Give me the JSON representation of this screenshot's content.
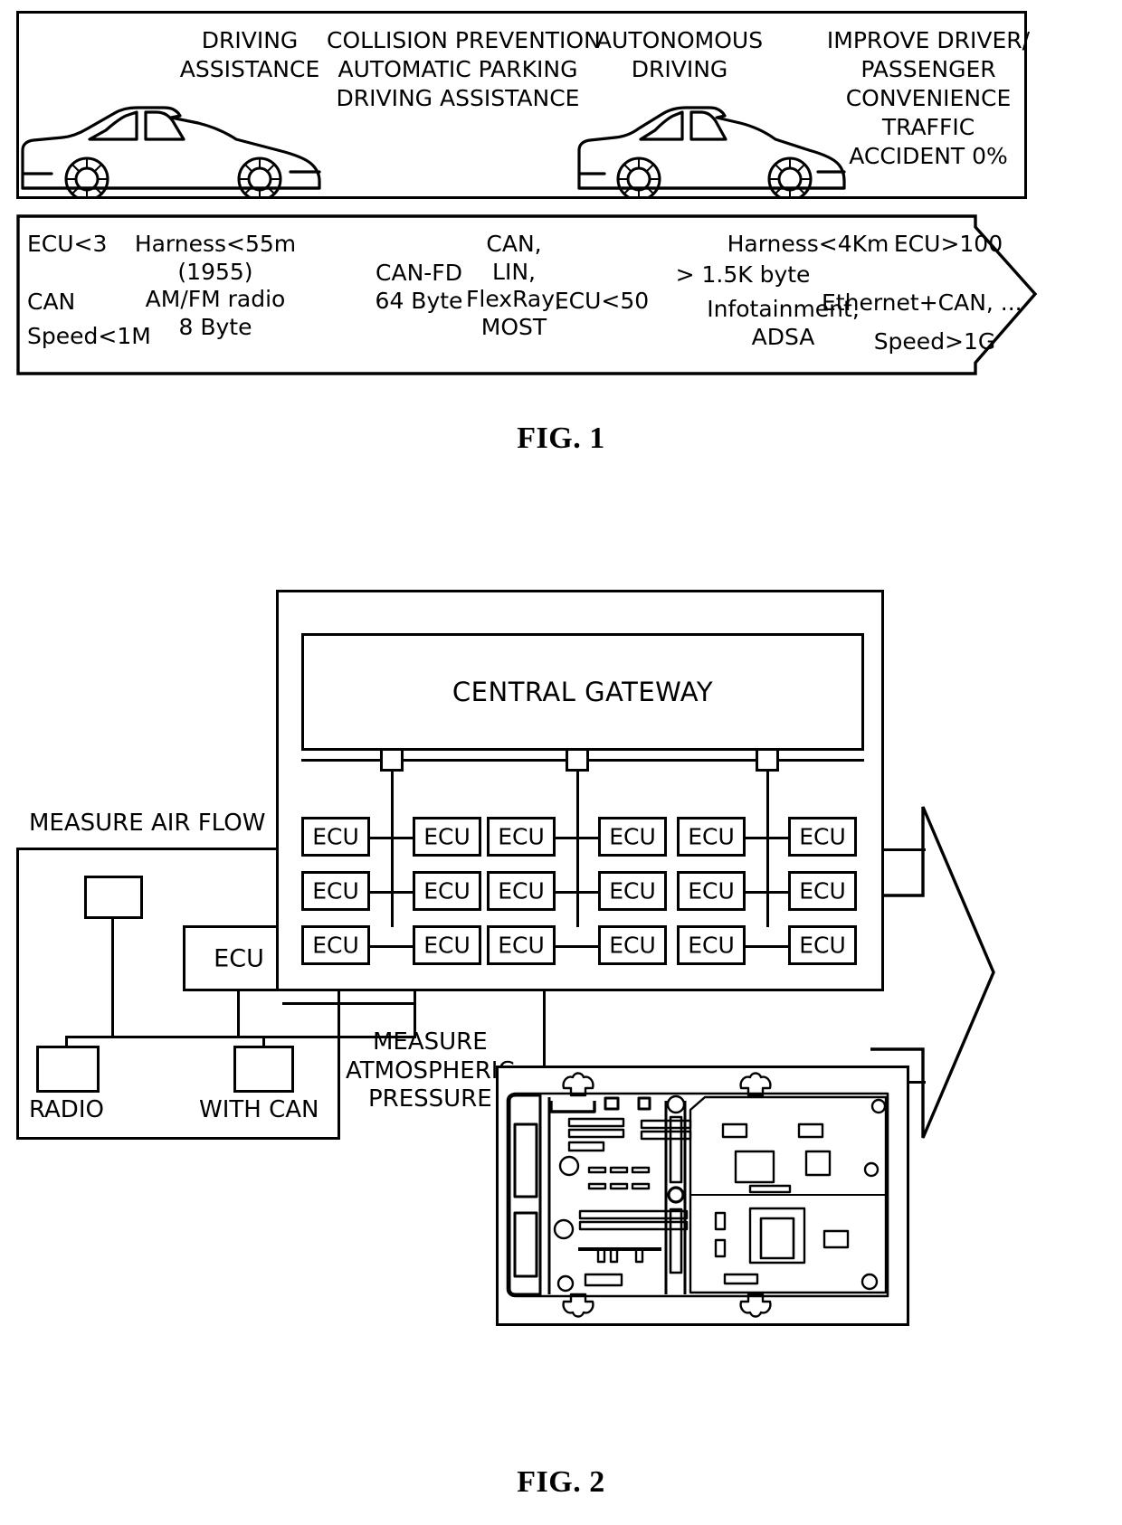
{
  "figure1": {
    "caption": "FIG. 1",
    "top_box": {
      "columns": [
        {
          "name": "driving-assistance",
          "lines": [
            "DRIVING",
            "ASSISTANCE"
          ]
        },
        {
          "name": "collision-prevention",
          "lines": [
            "COLLISION PREVENTION",
            "AUTOMATIC PARKING",
            "DRIVING ASSISTANCE"
          ]
        },
        {
          "name": "autonomous-driving",
          "lines": [
            "AUTONOMOUS",
            "DRIVING"
          ]
        },
        {
          "name": "improve-driver",
          "lines": [
            "IMPROVE DRIVER/",
            "PASSENGER",
            "CONVENIENCE",
            "TRAFFIC",
            "ACCIDENT 0%"
          ]
        }
      ],
      "vehicles": [
        "sedan-silhouette-left",
        "sedan-silhouette-right"
      ]
    },
    "timeline_arrow": {
      "groups": [
        {
          "name": "era-1-ecu",
          "lines": [
            "ECU<3",
            "",
            "CAN",
            "Speed<1M"
          ]
        },
        {
          "name": "era-1-harness",
          "lines": [
            "Harness<55m",
            "(1955)",
            "AM/FM radio",
            "8 Byte"
          ]
        },
        {
          "name": "era-2-canfd",
          "lines": [
            "CAN-FD",
            "64 Byte"
          ]
        },
        {
          "name": "era-2-buses",
          "lines": [
            "CAN,",
            "LIN,",
            "FlexRay,",
            "MOST"
          ]
        },
        {
          "name": "era-2-ecu",
          "lines": [
            "ECU<50"
          ]
        },
        {
          "name": "era-3-payload",
          "lines": [
            "> 1.5K byte"
          ]
        },
        {
          "name": "era-3-harness",
          "lines": [
            "Harness<4Km"
          ]
        },
        {
          "name": "era-3-infotainment",
          "lines": [
            "Infotainment,",
            "ADSA"
          ]
        },
        {
          "name": "era-4-ecu",
          "lines": [
            "ECU>100"
          ]
        },
        {
          "name": "era-4-network",
          "lines": [
            "Ethernet+CAN, ..."
          ]
        },
        {
          "name": "era-4-speed",
          "lines": [
            "Speed>1G"
          ]
        }
      ]
    }
  },
  "figure2": {
    "caption": "FIG. 2",
    "gateway": {
      "title": "CENTRAL GATEWAY",
      "node_count": 3,
      "ecu_label": "ECU",
      "ecu_rows": 3,
      "ecu_columns": 6
    },
    "left_panel": {
      "air_flow_label": "MEASURE AIR FLOW",
      "ecu_label": "ECU",
      "radio_label": "RADIO",
      "with_can_label": "WITH CAN",
      "atmospheric_label": [
        "MEASURE",
        "ATMOSPHERIC",
        "PRESSURE"
      ]
    },
    "pcb": {
      "name": "ecu-circuit-board-photo"
    },
    "arrow": {
      "name": "evolution-arrow-right"
    }
  },
  "style": {
    "ink": "#000000",
    "paper": "#ffffff"
  }
}
